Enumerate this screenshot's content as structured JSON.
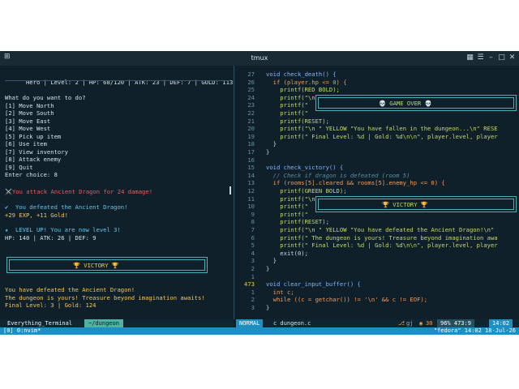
{
  "window": {
    "title": "tmux"
  },
  "left": {
    "stats": "Hero | Level: 2 | HP: 68/120 | ATK: 23 | DEF: 7 | GOLD: 113",
    "prompt": "What do you want to do?",
    "menu": [
      "[1] Move North",
      "[2] Move South",
      "[3] Move East",
      "[4] Move West",
      "[5] Pick up item",
      "[6] Use item",
      "[7] View inventory",
      "[8] Attack enemy",
      "[9] Quit"
    ],
    "enter_choice": "Enter choice: 8",
    "attack_msg": "⚔️You attack Ancient Dragon for 24 damage!",
    "defeated": "✔  You defeated the Ancient Dragon!",
    "reward": "+29 EXP, +11 Gold!",
    "levelup": "★  LEVEL UP! You are now level 3!",
    "newstats": "HP: 140 | ATK: 26 | DEF: 9",
    "victory_box": "🏆 VICTORY 🏆",
    "final1": "You have defeated the Ancient Dragon!",
    "final2": "The dungeon is yours! Treasure beyond imagination awaits!",
    "final3": "Final Level: 3 | Gold: 124"
  },
  "editor": {
    "lines": [
      {
        "n": "27",
        "t": "void check_death() {"
      },
      {
        "n": "26",
        "t": "  if (player.hp <= 0) {"
      },
      {
        "n": "25",
        "t": "    printf(RED BOLD);"
      },
      {
        "n": "24",
        "t": "    printf(\"\\n"
      },
      {
        "n": "23",
        "t": "    printf(\""
      },
      {
        "n": "22",
        "t": "    printf(\""
      },
      {
        "n": "21",
        "t": "    printf(RESET);"
      },
      {
        "n": "20",
        "t": "    printf(\"\\n \" YELLOW \"You have fallen in the dungeon...\\n\" RESE"
      },
      {
        "n": "19",
        "t": "    printf(\" Final Level: %d | Gold: %d\\n\\n\", player.level, player"
      },
      {
        "n": "18",
        "t": "  }"
      },
      {
        "n": "17",
        "t": "}"
      },
      {
        "n": "16",
        "t": ""
      },
      {
        "n": "15",
        "t": "void check_victory() {"
      },
      {
        "n": "14",
        "t": "  // Check if dragon is defeated (room 5)"
      },
      {
        "n": "13",
        "t": "  if (rooms[5].cleared && rooms[5].enemy_hp <= 0) {"
      },
      {
        "n": "12",
        "t": "    printf(GREEN BOLD);"
      },
      {
        "n": "11",
        "t": "    printf(\"\\n"
      },
      {
        "n": "10",
        "t": "    printf(\""
      },
      {
        "n": "9",
        "t": "    printf(\""
      },
      {
        "n": "8",
        "t": "    printf(RESET);"
      },
      {
        "n": "7",
        "t": "    printf(\"\\n \" YELLOW \"You have defeated the Ancient Dragon!\\n\""
      },
      {
        "n": "6",
        "t": "    printf(\" The dungeon is yours! Treasure beyond imagination awa"
      },
      {
        "n": "5",
        "t": "    printf(\" Final Level: %d | Gold: %d\\n\\n\", player.level, player"
      },
      {
        "n": "4",
        "t": "    exit(0);"
      },
      {
        "n": "3",
        "t": "  }"
      },
      {
        "n": "2",
        "t": "}"
      },
      {
        "n": "1",
        "t": ""
      },
      {
        "n": "473",
        "t": "void clear_input_buffer() {"
      },
      {
        "n": "1",
        "t": "  int c;"
      },
      {
        "n": "2",
        "t": "  while ((c = getchar()) != '\\n' && c != EOF);"
      },
      {
        "n": "3",
        "t": "}"
      }
    ],
    "game_over_box": "💀 GAME OVER 💀",
    "victory_box": "🏆 VICTORY 🏆",
    "status_mode": "NORMAL",
    "status_file": "c  dungeon.c",
    "status_right": "96%  473:9",
    "status_time": "14:02",
    "status_extra": "gj",
    "status_num": "30"
  },
  "leftstatus": {
    "left": "Everything_Terminal",
    "right": "~/dungeon"
  },
  "tmux": {
    "left": "[0] 0:nvim*",
    "right": "\"fedora\" 14:02 18-Jul-26"
  }
}
